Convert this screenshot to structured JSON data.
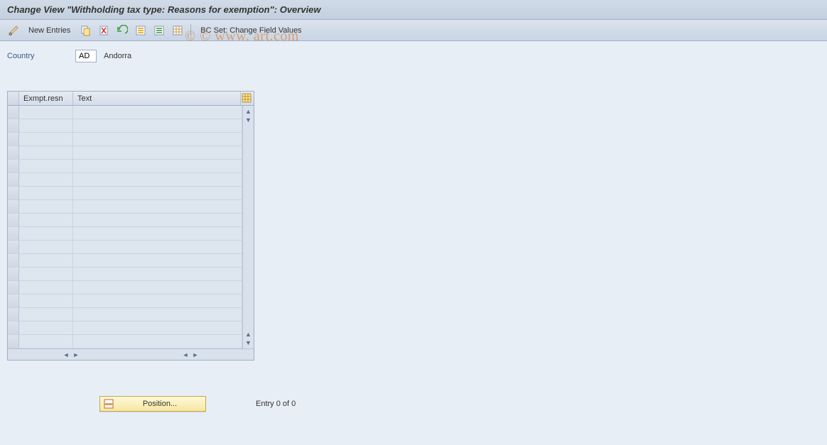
{
  "title": "Change View \"Withholding tax type: Reasons for exemption\": Overview",
  "toolbar": {
    "new_entries": "New Entries",
    "bcset": "BC Set: Change Field Values"
  },
  "country": {
    "label": "Country",
    "value": "AD",
    "desc": "Andorra"
  },
  "table": {
    "columns": {
      "exmpt": "Exmpt.resn",
      "text": "Text"
    },
    "row_count": 18
  },
  "position": {
    "label": "Position..."
  },
  "status": {
    "entry_text": "Entry 0 of 0"
  },
  "watermark": "© © www.            art.com"
}
